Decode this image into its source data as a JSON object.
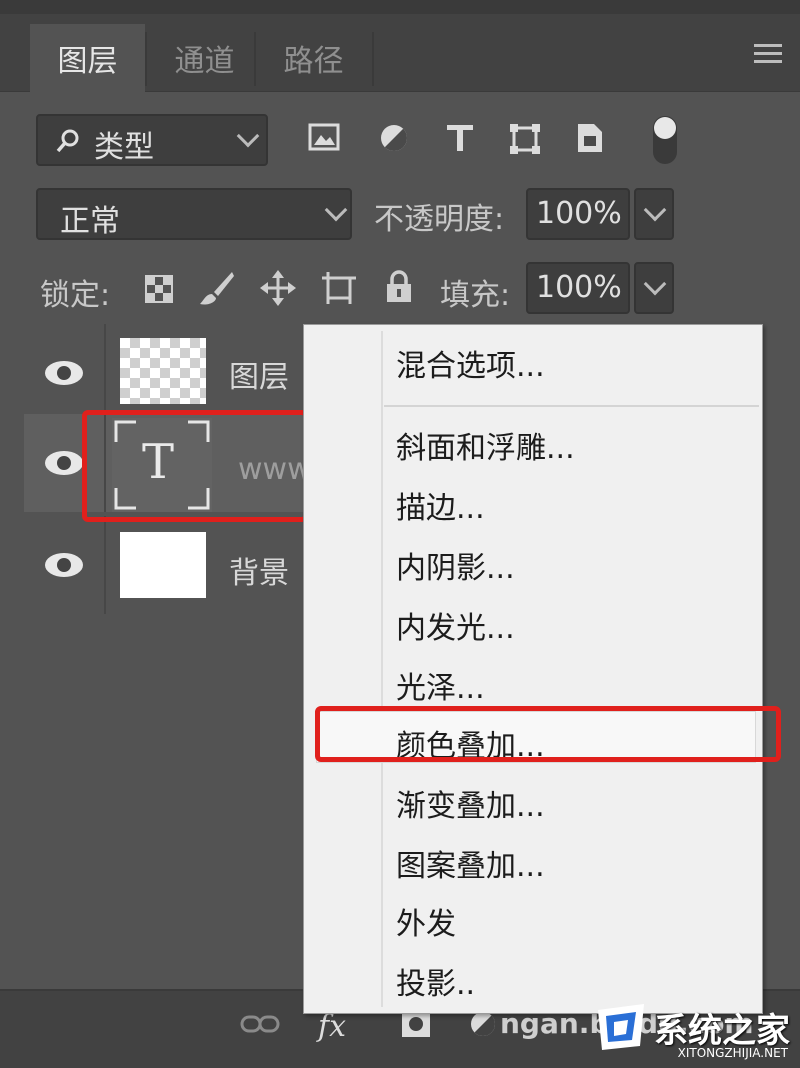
{
  "panel": {
    "tabs": [
      {
        "label": "图层"
      },
      {
        "label": "通道"
      },
      {
        "label": "路径"
      }
    ]
  },
  "filter": {
    "kind_label": "类型",
    "icons": [
      "image-filter-icon",
      "adjustment-filter-icon",
      "type-filter-icon",
      "shape-filter-icon",
      "smart-object-filter-icon"
    ]
  },
  "blend": {
    "mode": "正常",
    "opacity_label": "不透明度:",
    "opacity_value": "100%"
  },
  "lock": {
    "label": "锁定:",
    "fill_label": "填充:",
    "fill_value": "100%"
  },
  "layers": [
    {
      "name": "图层"
    },
    {
      "name": "www"
    },
    {
      "name": "背景"
    }
  ],
  "text_layer_glyph": "T",
  "context_menu": {
    "items": [
      {
        "label": "混合选项..."
      },
      {
        "label": "斜面和浮雕..."
      },
      {
        "label": "描边..."
      },
      {
        "label": "内阴影..."
      },
      {
        "label": "内发光..."
      },
      {
        "label": "光泽..."
      },
      {
        "label": "颜色叠加..."
      },
      {
        "label": "渐变叠加..."
      },
      {
        "label": "图案叠加..."
      },
      {
        "label": "外发"
      },
      {
        "label": "投影.."
      }
    ]
  },
  "bottom": {
    "fx_label": "fx",
    "partial_text": "ngan.baidu.com"
  },
  "watermark": {
    "text": "系统之家",
    "sub": "XITONGZHIJIA.NET"
  },
  "colors": {
    "highlight_red": "#e0201c",
    "panel_bg": "#535353",
    "menu_bg": "#f0f0f0"
  }
}
